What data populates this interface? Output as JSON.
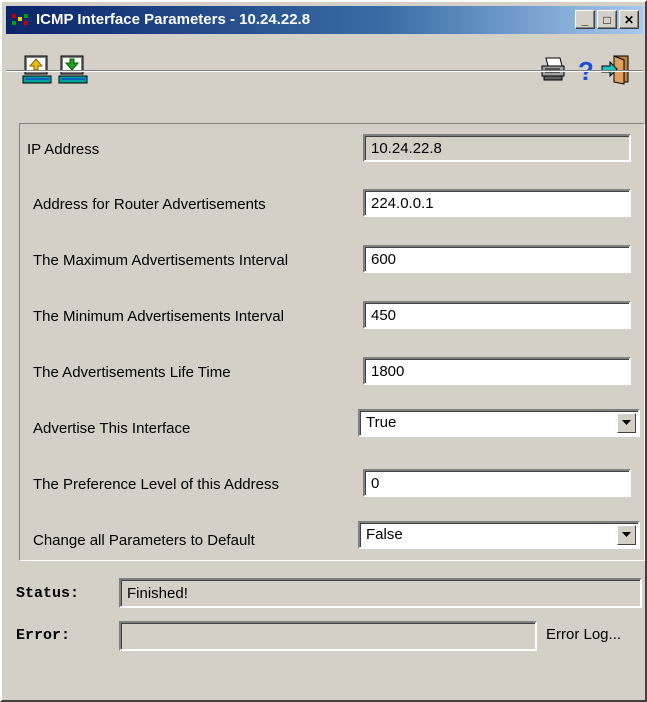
{
  "window": {
    "title": "ICMP Interface Parameters - 10.24.22.8",
    "controls": {
      "minimize": "_",
      "maximize": "□",
      "close": "✕"
    }
  },
  "toolbar": {
    "icons": [
      "upload-config-icon",
      "download-config-icon",
      "print-icon",
      "help-icon",
      "exit-icon"
    ]
  },
  "form": {
    "ip_address": {
      "label": "IP Address",
      "value": "10.24.22.8"
    },
    "router_adv_address": {
      "label": "Address for Router Advertisements",
      "value": "224.0.0.1"
    },
    "max_adv_interval": {
      "label": "The Maximum Advertisements Interval",
      "value": "600"
    },
    "min_adv_interval": {
      "label": "The Minimum Advertisements Interval",
      "value": "450"
    },
    "adv_lifetime": {
      "label": "The Advertisements Life Time",
      "value": "1800"
    },
    "advertise_interface": {
      "label": "Advertise This Interface",
      "value": "True"
    },
    "preference_level": {
      "label": "The Preference Level of this Address",
      "value": "0"
    },
    "change_to_default": {
      "label": "Change all Parameters to Default",
      "value": "False"
    }
  },
  "status": {
    "label": "Status:",
    "value": "Finished!"
  },
  "error": {
    "label": "Error:",
    "value": "",
    "log_link": "Error Log..."
  },
  "colors": {
    "titlebar_start": "#0a246a",
    "titlebar_end": "#a6caf0",
    "window_bg": "#d4d0c8"
  }
}
